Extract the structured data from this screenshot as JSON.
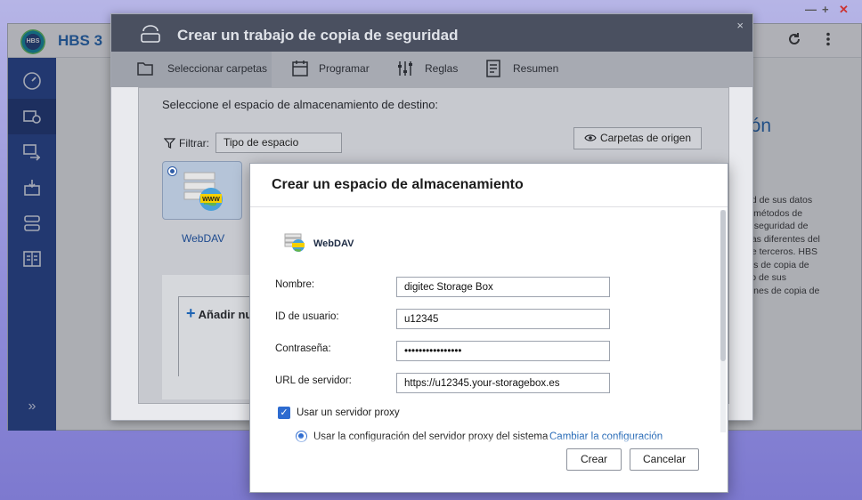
{
  "window_controls": {
    "minimize": "—",
    "maximize": "+",
    "close": "✕"
  },
  "app": {
    "logo_text": "HBS",
    "title": "HBS 3",
    "header_icons": [
      "refresh-icon",
      "more-vert-icon"
    ],
    "sidebar_icons": [
      "dashboard-icon",
      "backup-icon",
      "sync-icon",
      "restore-icon",
      "storage-icon",
      "logs-icon"
    ],
    "sidebar_expand": "»",
    "background_heading": "ión",
    "background_lines": [
      "ad de sus datos",
      "s métodos de",
      "e seguridad de",
      "eas diferentes del",
      "de terceros. HBS",
      "jos de copia de",
      "so de sus",
      "iones de copia de"
    ]
  },
  "wizard": {
    "title": "Crear un trabajo de copia de seguridad",
    "close": "×",
    "steps": [
      {
        "label": "Seleccionar carpetas",
        "icon": "folders-icon",
        "active": true
      },
      {
        "label": "Programar",
        "icon": "calendar-icon",
        "active": false
      },
      {
        "label": "Reglas",
        "icon": "sliders-icon",
        "active": false
      },
      {
        "label": "Resumen",
        "icon": "summary-icon",
        "active": false
      }
    ],
    "prompt": "Seleccione el espacio de almacenamiento de destino:",
    "filter_label": "Filtrar:",
    "filter_value": "Tipo de espacio",
    "source_button": "Carpetas de origen",
    "tile_label": "WebDAV",
    "add_label": "Añadir nu"
  },
  "dialog": {
    "title": "Crear un espacio de almacenamiento",
    "service": "WebDAV",
    "fields": {
      "name": {
        "label": "Nombre:",
        "value": "digitec Storage Box"
      },
      "user": {
        "label": "ID de usuario:",
        "value": "u12345"
      },
      "password": {
        "label": "Contraseña:",
        "value": "••••••••••••••••"
      },
      "url": {
        "label": "URL de servidor:",
        "value": "https://u12345.your-storagebox.es"
      }
    },
    "proxy_checkbox": "Usar un servidor proxy",
    "proxy_checked": true,
    "proxy_option": "Usar la configuración del servidor proxy del sistema",
    "proxy_link": "Cambiar la configuración",
    "create_button": "Crear",
    "cancel_button": "Cancelar"
  }
}
